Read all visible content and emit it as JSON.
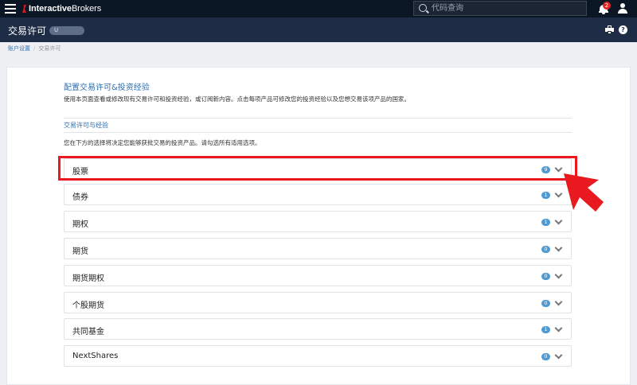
{
  "topbar": {
    "brand": {
      "bold": "Interactive",
      "rest": "Brokers"
    },
    "search_placeholder": "代码查询",
    "notification_count": "2"
  },
  "header": {
    "title": "交易许可",
    "account": "U"
  },
  "breadcrumb": {
    "parent": "账户设置",
    "current": "交易许可"
  },
  "main": {
    "heading": "配置交易许可&投资经验",
    "description": "使用本页面查看或修改现有交易许可和投资经验，或订阅新内容。点击每项产品可修改您的投资经验以及您想交易该项产品的国家。",
    "subheading": "交易许可与经验",
    "subdescription": "您在下方的选择将决定您能够获批交易的投资产品。请勾选所有适用选项。",
    "permissions": [
      {
        "label": "股票",
        "count": "9"
      },
      {
        "label": "债券",
        "count": "1"
      },
      {
        "label": "期权",
        "count": "1"
      },
      {
        "label": "期货",
        "count": "0"
      },
      {
        "label": "期货期权",
        "count": "0"
      },
      {
        "label": "个股期货",
        "count": "0"
      },
      {
        "label": "共同基金",
        "count": "1"
      },
      {
        "label": "NextShares",
        "count": "0"
      }
    ]
  },
  "colors": {
    "topbar_bg": "#0b1624",
    "header_bg": "#1e2d45",
    "accent_blue": "#2f6fb0",
    "badge_blue": "#4f9ad3",
    "highlight_red": "#e8191f"
  }
}
